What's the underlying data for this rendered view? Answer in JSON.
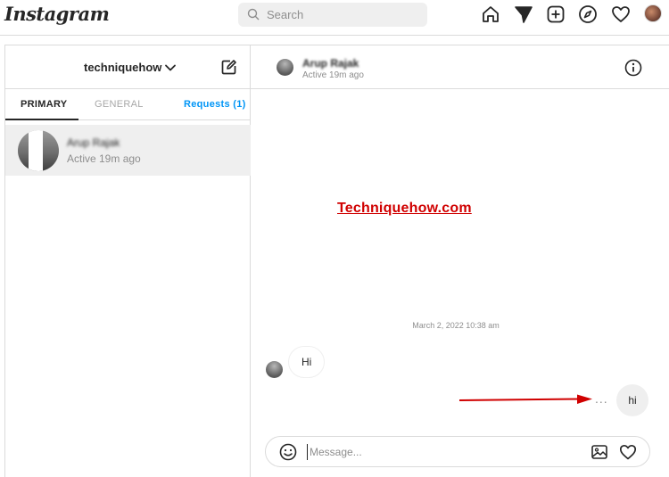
{
  "app": {
    "logo": "Instagram"
  },
  "search": {
    "placeholder": "Search"
  },
  "nav": {
    "icons": [
      "home-icon",
      "direct-icon",
      "new-post-icon",
      "explore-icon",
      "activity-heart-icon",
      "profile-avatar"
    ]
  },
  "inbox": {
    "username": "techniquehow",
    "tabs": {
      "primary": "PRIMARY",
      "general": "GENERAL",
      "requests": "Requests (1)"
    },
    "threads": [
      {
        "name": "Arup Rajak",
        "status": "Active 19m ago"
      }
    ]
  },
  "chat": {
    "name": "Arup Rajak",
    "status": "Active 19m ago",
    "watermark": "Techniquehow.com",
    "timestamp": "March 2, 2022 10:38 am",
    "messages": [
      {
        "direction": "incoming",
        "text": "Hi"
      },
      {
        "direction": "outgoing",
        "text": "hi"
      }
    ],
    "more_options": "...",
    "composer": {
      "placeholder": "Message..."
    }
  },
  "colors": {
    "accent_blue": "#0095f6",
    "annotation_red": "#d00000",
    "border": "#dbdbdb",
    "muted_text": "#8e8e8e"
  }
}
